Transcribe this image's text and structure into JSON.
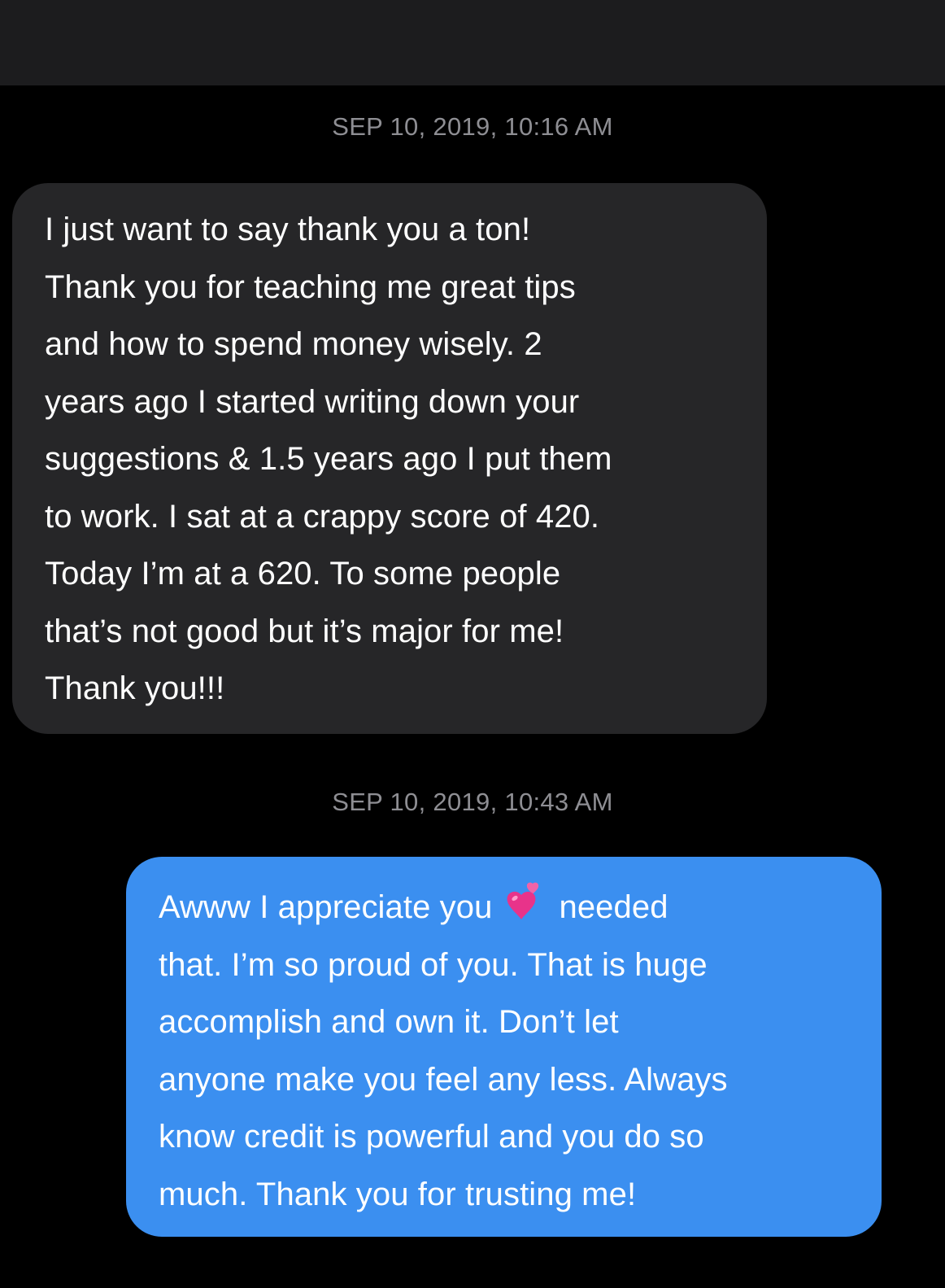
{
  "thread": {
    "messages": [
      {
        "timestamp": "SEP 10, 2019, 10:16 AM",
        "direction": "incoming",
        "lines": [
          "I just want to say thank you a ton!",
          "Thank you for teaching me great tips",
          "and how to spend money wisely. 2",
          "years ago I started writing down your",
          "suggestions & 1.5 years ago I put them",
          "to work. I sat at a crappy score of 420.",
          "Today I’m at a 620. To some people",
          "that’s not good but it’s major for me!",
          "Thank you!!!"
        ]
      },
      {
        "timestamp": "SEP 10, 2019, 10:43 AM",
        "direction": "outgoing",
        "lines": [
          {
            "before": "Awww I appreciate you",
            "emoji": "two-hearts-icon",
            "after": "needed"
          },
          "that. I’m so proud of you. That is huge",
          "accomplish and own it. Don’t let",
          "anyone make you feel any less. Always",
          "know credit is powerful and you do so",
          "much. Thank you for trusting me!"
        ]
      }
    ]
  },
  "colors": {
    "background": "#000000",
    "top_bar": "#1c1c1e",
    "incoming_bubble": "#262628",
    "outgoing_bubble": "#3b8ff0",
    "timestamp_text": "#8e8e93",
    "message_text": "#ffffff",
    "emoji_heart": "#e8338a"
  }
}
